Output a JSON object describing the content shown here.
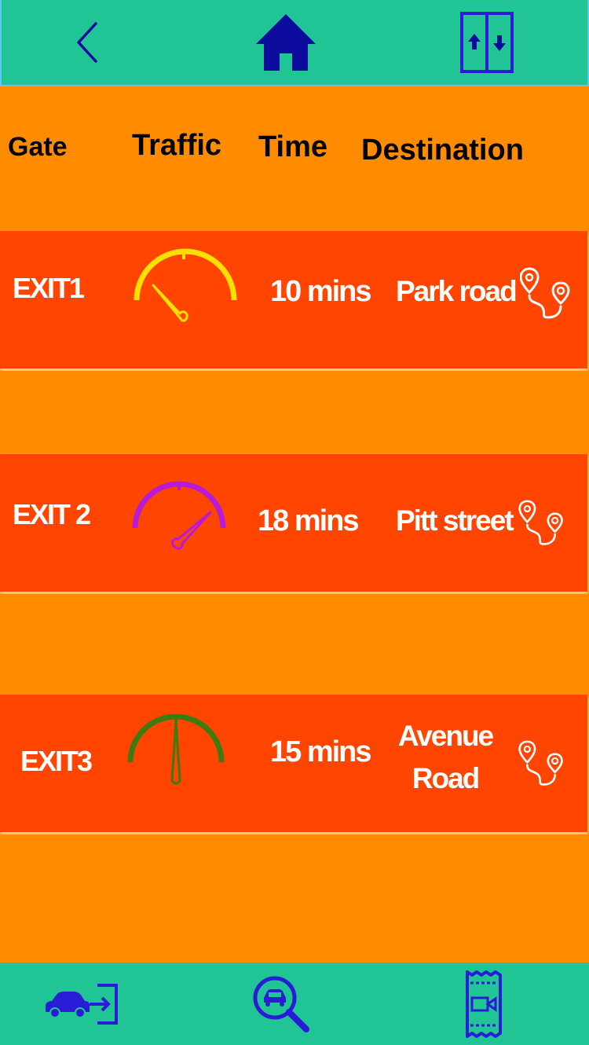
{
  "top_nav": {
    "back": "back-chevron-icon",
    "home": "home-icon",
    "swap": "elevator-swap-icon",
    "accent_color": "#0B0B9E"
  },
  "header": {
    "gate": "Gate",
    "traffic": "Traffic",
    "time": "Time",
    "destination": "Destination"
  },
  "exits": [
    {
      "gate": "EXIT1",
      "traffic_color": "#FFE000",
      "time": "10 mins",
      "destination": "Park road"
    },
    {
      "gate": "EXIT 2",
      "traffic_color": "#B81AD6",
      "time": "18 mins",
      "destination": "Pitt street"
    },
    {
      "gate": "EXIT3",
      "traffic_color": "#3E7A10",
      "time": "15 mins",
      "destination": "Avenue Road"
    }
  ],
  "bottom_nav": {
    "enter": "car-enter-icon",
    "search": "car-search-icon",
    "ticket": "video-ticket-icon",
    "accent_color": "#2A1BD6"
  },
  "colors": {
    "bar": "#20C495",
    "background": "#FF8C00",
    "row": "#FF4500"
  }
}
